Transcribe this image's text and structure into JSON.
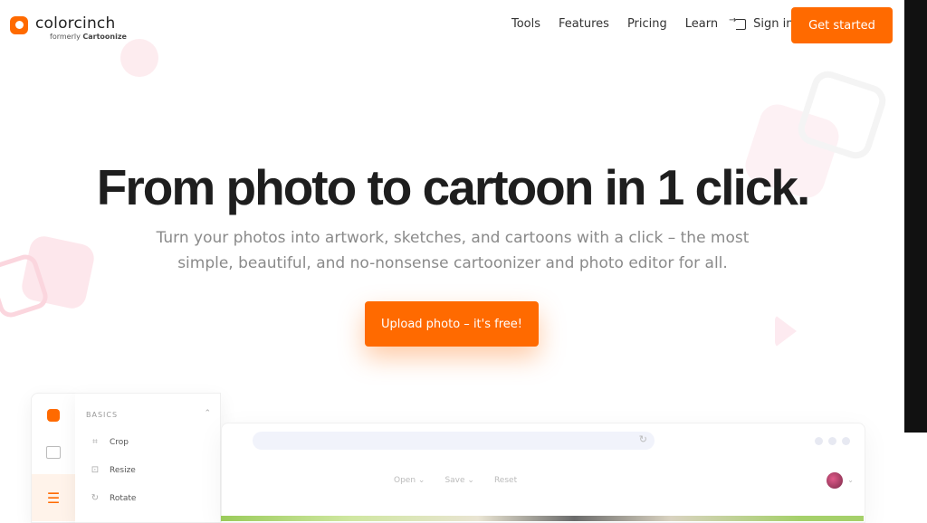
{
  "brand": {
    "name": "colorcinch",
    "formerly_prefix": "formerly",
    "formerly_name": "Cartoonize"
  },
  "nav": {
    "tools": "Tools",
    "features": "Features",
    "pricing": "Pricing",
    "learn": "Learn",
    "sign_in": "Sign in",
    "get_started": "Get started"
  },
  "hero": {
    "title": "From photo to cartoon in 1 click.",
    "subtitle": "Turn your photos into artwork, sketches, and cartoons with a click – the most simple, beautiful, and no-nonsense cartoonizer and photo editor for all.",
    "cta": "Upload photo – it's free!"
  },
  "editor_mock": {
    "section": "BASICS",
    "tools": [
      "Crop",
      "Resize",
      "Rotate"
    ],
    "menus": [
      "Open ⌄",
      "Save ⌄",
      "Reset"
    ]
  },
  "colors": {
    "accent": "#ff6a00",
    "text": "#1e1e1e",
    "muted": "#8a8a8a"
  },
  "icons": [
    "logo-icon",
    "sign-in-icon",
    "image-icon",
    "adjust-icon",
    "crop-icon",
    "resize-icon",
    "rotate-icon",
    "reload-icon",
    "chevron-down-icon"
  ]
}
